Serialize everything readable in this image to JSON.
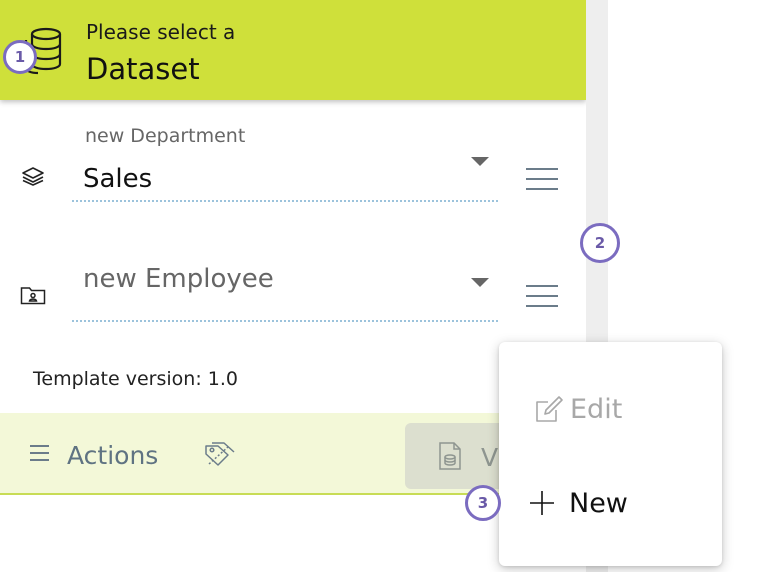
{
  "dataset": {
    "prompt": "Please select a",
    "title": "Dataset",
    "badge": "1"
  },
  "department": {
    "label": "new Department",
    "value": "Sales",
    "icon": "layers-icon"
  },
  "employee": {
    "placeholder": "new Employee",
    "icon": "folder-person-icon"
  },
  "scroll_badge": "2",
  "template_version": "Template version: 1.0",
  "actions": {
    "label": "Actions",
    "view_label": "V"
  },
  "context_menu": {
    "edit_label": "Edit",
    "new_label": "New",
    "badge": "3"
  },
  "colors": {
    "accent": "#cfe03a",
    "actions_bg": "#f3f8d8",
    "badge_border": "#7b6cc0"
  }
}
